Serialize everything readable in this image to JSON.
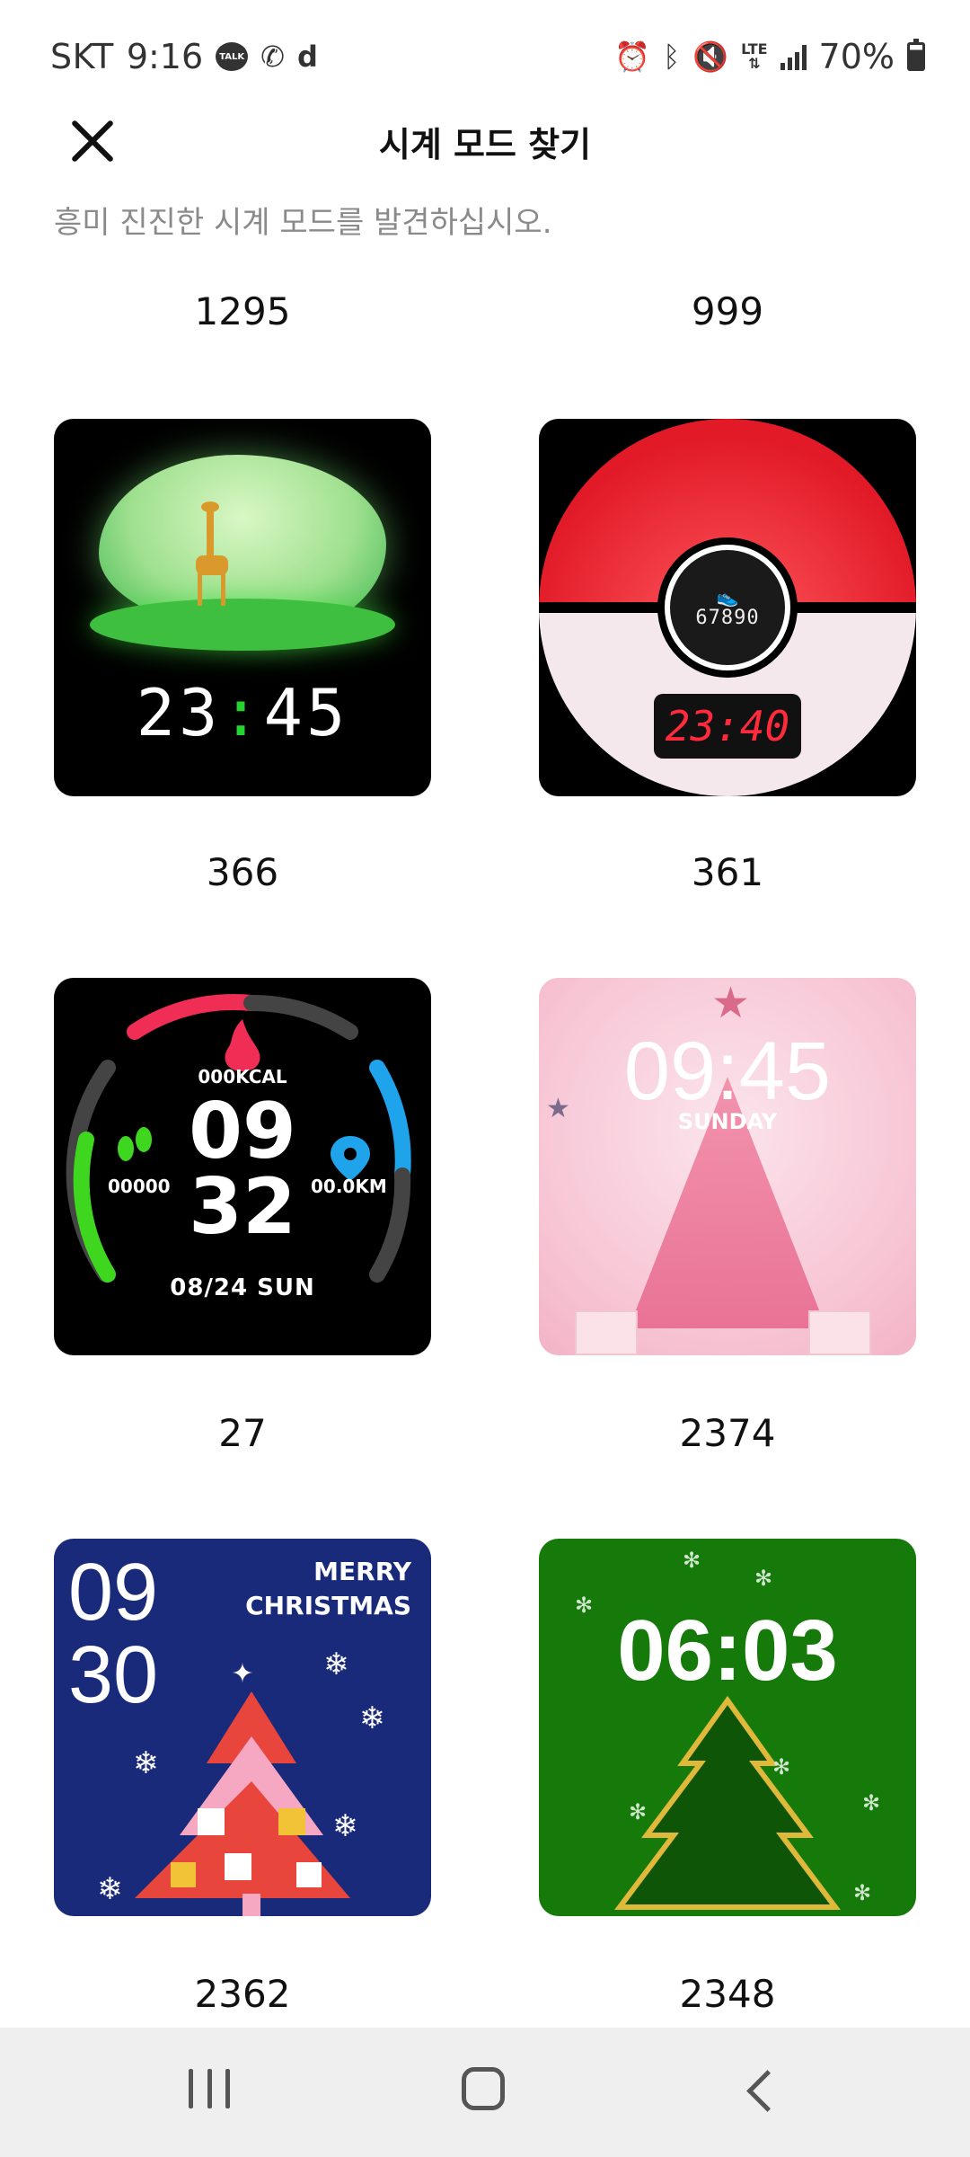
{
  "status_bar": {
    "carrier": "SKT",
    "time": "9:16",
    "talk_badge": "TALK",
    "battery_pct": "70%",
    "lte": "LTE",
    "battery_level": 0.7,
    "icons": [
      "talk-icon",
      "phone-icon",
      "d-icon",
      "alarm-icon",
      "bluetooth-icon",
      "mute-icon",
      "lte-icon",
      "signal-icon",
      "battery-icon"
    ]
  },
  "header": {
    "title": "시계 모드 찾기",
    "subtitle": "흥미 진진한 시계 모드를 발견하십시오."
  },
  "top_labels": [
    "1295",
    "999"
  ],
  "faces": [
    {
      "id": "366",
      "time_h": "23",
      "time_m": "45",
      "colon": ":"
    },
    {
      "id": "361",
      "steps": "67890",
      "time": "23:40"
    },
    {
      "id": "27",
      "kcal": "000KCAL",
      "steps": "00000",
      "km": "00.0KM",
      "hh": "09",
      "mm": "32",
      "date": "08/24  SUN"
    },
    {
      "id": "2374",
      "time": "09:45",
      "day": "SUNDAY"
    },
    {
      "id": "2362",
      "hh": "09",
      "mm": "30",
      "greeting_1": "MERRY",
      "greeting_2": "CHRISTMAS"
    },
    {
      "id": "2348",
      "time": "06:03"
    }
  ],
  "colors": {
    "accent_green": "#25d42e",
    "pokeball_red": "#e21a28",
    "navy": "#1a2a7a",
    "forest_green": "#167a0a"
  }
}
